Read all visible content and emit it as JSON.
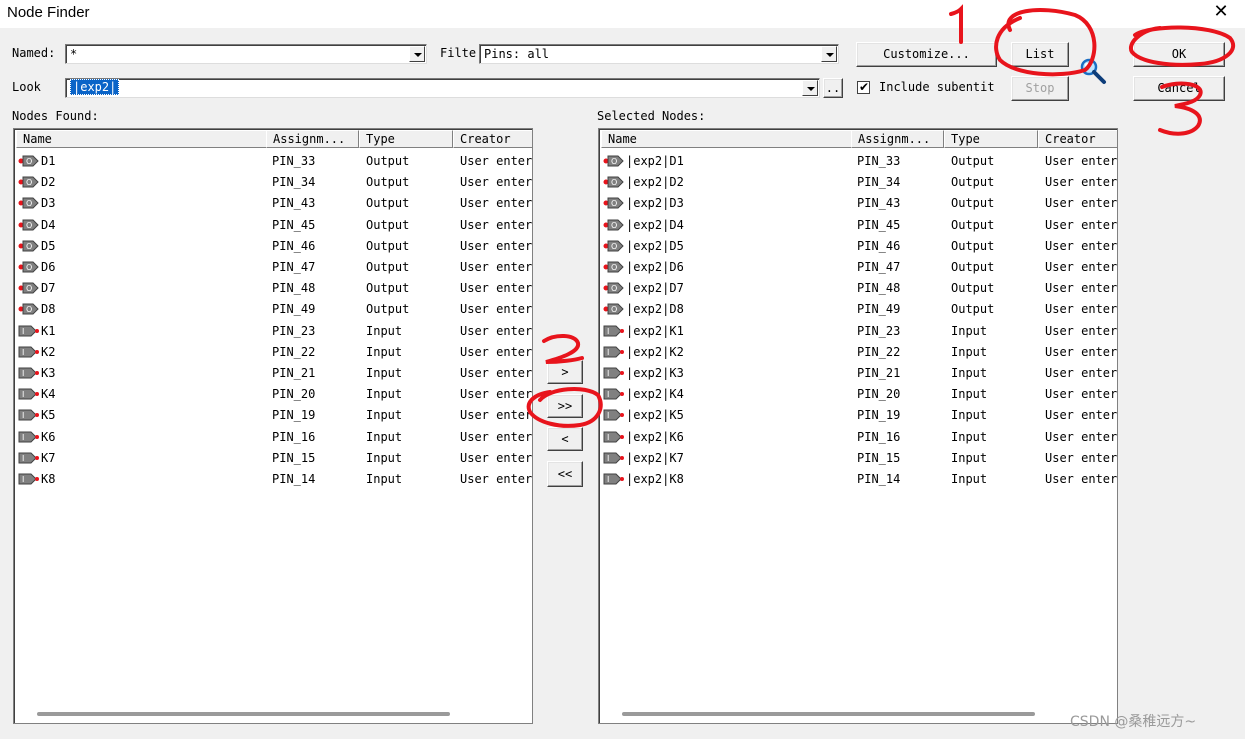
{
  "window": {
    "title": "Node Finder"
  },
  "search": {
    "named_label": "Named:",
    "named_value": "*",
    "filter_label": "Filte",
    "filter_value": "Pins: all",
    "look_label": "Look",
    "look_value": "|exp2|",
    "browse_label": "..",
    "include_subentities_label": "Include subentit",
    "include_subentities_checked": true
  },
  "buttons": {
    "customize": "Customize...",
    "list": "List",
    "stop": "Stop",
    "ok": "OK",
    "cancel": "Cancel",
    "move_one_right": ">",
    "move_all_right": ">>",
    "move_one_left": "<",
    "move_all_left": "<<"
  },
  "nodes_found": {
    "label": "Nodes Found:",
    "columns": [
      "Name",
      "Assignm...",
      "Type",
      "Creator"
    ],
    "rows": [
      {
        "name": "D1",
        "assignment": "PIN_33",
        "type": "Output",
        "creator": "User enter"
      },
      {
        "name": "D2",
        "assignment": "PIN_34",
        "type": "Output",
        "creator": "User enter"
      },
      {
        "name": "D3",
        "assignment": "PIN_43",
        "type": "Output",
        "creator": "User enter"
      },
      {
        "name": "D4",
        "assignment": "PIN_45",
        "type": "Output",
        "creator": "User enter"
      },
      {
        "name": "D5",
        "assignment": "PIN_46",
        "type": "Output",
        "creator": "User enter"
      },
      {
        "name": "D6",
        "assignment": "PIN_47",
        "type": "Output",
        "creator": "User enter"
      },
      {
        "name": "D7",
        "assignment": "PIN_48",
        "type": "Output",
        "creator": "User enter"
      },
      {
        "name": "D8",
        "assignment": "PIN_49",
        "type": "Output",
        "creator": "User enter"
      },
      {
        "name": "K1",
        "assignment": "PIN_23",
        "type": "Input",
        "creator": "User enter"
      },
      {
        "name": "K2",
        "assignment": "PIN_22",
        "type": "Input",
        "creator": "User enter"
      },
      {
        "name": "K3",
        "assignment": "PIN_21",
        "type": "Input",
        "creator": "User enter"
      },
      {
        "name": "K4",
        "assignment": "PIN_20",
        "type": "Input",
        "creator": "User enter"
      },
      {
        "name": "K5",
        "assignment": "PIN_19",
        "type": "Input",
        "creator": "User enter"
      },
      {
        "name": "K6",
        "assignment": "PIN_16",
        "type": "Input",
        "creator": "User enter"
      },
      {
        "name": "K7",
        "assignment": "PIN_15",
        "type": "Input",
        "creator": "User enter"
      },
      {
        "name": "K8",
        "assignment": "PIN_14",
        "type": "Input",
        "creator": "User enter"
      }
    ]
  },
  "selected_nodes": {
    "label": "Selected Nodes:",
    "columns": [
      "Name",
      "Assignm...",
      "Type",
      "Creator"
    ],
    "rows": [
      {
        "name": "|exp2|D1",
        "assignment": "PIN_33",
        "type": "Output",
        "creator": "User enter"
      },
      {
        "name": "|exp2|D2",
        "assignment": "PIN_34",
        "type": "Output",
        "creator": "User enter"
      },
      {
        "name": "|exp2|D3",
        "assignment": "PIN_43",
        "type": "Output",
        "creator": "User enter"
      },
      {
        "name": "|exp2|D4",
        "assignment": "PIN_45",
        "type": "Output",
        "creator": "User enter"
      },
      {
        "name": "|exp2|D5",
        "assignment": "PIN_46",
        "type": "Output",
        "creator": "User enter"
      },
      {
        "name": "|exp2|D6",
        "assignment": "PIN_47",
        "type": "Output",
        "creator": "User enter"
      },
      {
        "name": "|exp2|D7",
        "assignment": "PIN_48",
        "type": "Output",
        "creator": "User enter"
      },
      {
        "name": "|exp2|D8",
        "assignment": "PIN_49",
        "type": "Output",
        "creator": "User enter"
      },
      {
        "name": "|exp2|K1",
        "assignment": "PIN_23",
        "type": "Input",
        "creator": "User enter"
      },
      {
        "name": "|exp2|K2",
        "assignment": "PIN_22",
        "type": "Input",
        "creator": "User enter"
      },
      {
        "name": "|exp2|K3",
        "assignment": "PIN_21",
        "type": "Input",
        "creator": "User enter"
      },
      {
        "name": "|exp2|K4",
        "assignment": "PIN_20",
        "type": "Input",
        "creator": "User enter"
      },
      {
        "name": "|exp2|K5",
        "assignment": "PIN_19",
        "type": "Input",
        "creator": "User enter"
      },
      {
        "name": "|exp2|K6",
        "assignment": "PIN_16",
        "type": "Input",
        "creator": "User enter"
      },
      {
        "name": "|exp2|K7",
        "assignment": "PIN_15",
        "type": "Input",
        "creator": "User enter"
      },
      {
        "name": "|exp2|K8",
        "assignment": "PIN_14",
        "type": "Input",
        "creator": "User enter"
      }
    ]
  },
  "annotations": {
    "step1": "1",
    "step2": "2",
    "step3": "3",
    "color": "#e8141c"
  },
  "watermark": "CSDN @桑稚远方~",
  "icons": {
    "search": "magnifier-icon",
    "output_pin": "output-pin-icon",
    "input_pin": "input-pin-icon"
  }
}
